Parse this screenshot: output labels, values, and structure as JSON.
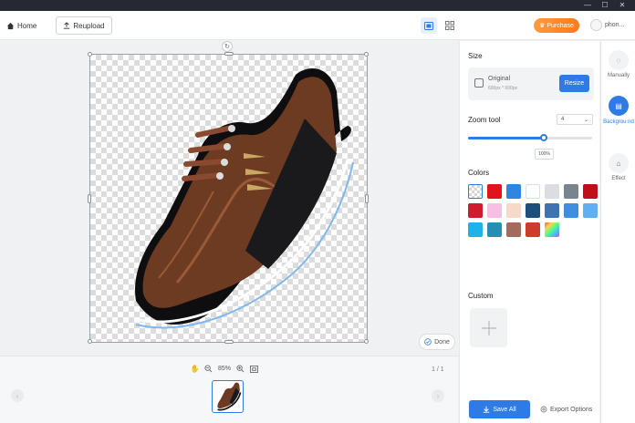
{
  "topbar": {
    "home_label": "Home",
    "reupload_label": "Reupload",
    "purchase_label": "Purchase",
    "user_label": "phon..."
  },
  "canvas": {
    "done_label": "Done",
    "zoom_percent": "85%",
    "page_info": "1 / 1"
  },
  "panel": {
    "size_title": "Size",
    "size_option_name": "Original",
    "size_option_dims": "600px * 600px",
    "resize_label": "Resize",
    "zoom_tool_title": "Zoom tool",
    "zoom_select_value": "4",
    "zoom_slider_value": "100%",
    "zoom_slider_fraction": 0.61,
    "colors_title": "Colors",
    "custom_title": "Custom",
    "save_all_label": "Save All",
    "export_label": "Export Options",
    "swatches": [
      "transparent",
      "#e0141a",
      "#2f86e0",
      "#ffffff",
      "#dcdde1",
      "#7a8491",
      "#c40d1a",
      "#cf1b2b",
      "#f7bfe3",
      "#f6d9c8",
      "#1d4f7c",
      "#3d73b3",
      "#3f8ee0",
      "#5eb0f0",
      "#1db2ea",
      "#248eb3",
      "#a46a5e",
      "#cc3b2c",
      "rainbow"
    ]
  },
  "rail": {
    "items": [
      {
        "label": "Manually"
      },
      {
        "label": "Backgrou nd"
      },
      {
        "label": "Effect"
      }
    ]
  }
}
